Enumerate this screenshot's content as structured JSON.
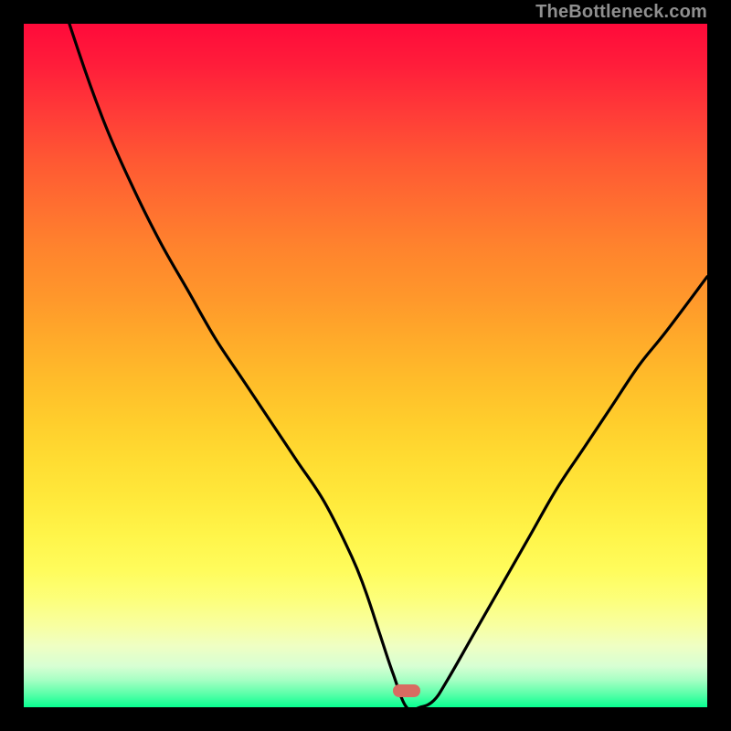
{
  "watermark": "TheBottleneck.com",
  "chart_data": {
    "type": "line",
    "title": "",
    "xlabel": "",
    "ylabel": "",
    "xlim": [
      0,
      100
    ],
    "ylim": [
      0,
      100
    ],
    "grid": false,
    "legend": false,
    "minimum_point": {
      "x": 56,
      "y": 0
    },
    "marker": {
      "x": 56,
      "y": 2,
      "color": "#d86c62"
    },
    "series": [
      {
        "name": "bottleneck-curve",
        "x": [
          0,
          4,
          8,
          12,
          16,
          20,
          24,
          28,
          32,
          36,
          40,
          44,
          48,
          50,
          52,
          54,
          56,
          58,
          60,
          62,
          66,
          70,
          74,
          78,
          82,
          86,
          90,
          94,
          100
        ],
        "y": [
          126,
          109,
          96,
          85,
          76,
          68,
          61,
          54,
          48,
          42,
          36,
          30,
          22,
          17,
          11,
          5,
          0,
          0,
          1,
          4,
          11,
          18,
          25,
          32,
          38,
          44,
          50,
          55,
          63
        ]
      }
    ],
    "background_gradient_stops": [
      {
        "pos": 0.0,
        "color": "#ff0a3a"
      },
      {
        "pos": 0.25,
        "color": "#ff7a2f"
      },
      {
        "pos": 0.5,
        "color": "#ffc22a"
      },
      {
        "pos": 0.75,
        "color": "#fff54a"
      },
      {
        "pos": 0.95,
        "color": "#b8ffcd"
      },
      {
        "pos": 1.0,
        "color": "#08ff91"
      }
    ]
  }
}
